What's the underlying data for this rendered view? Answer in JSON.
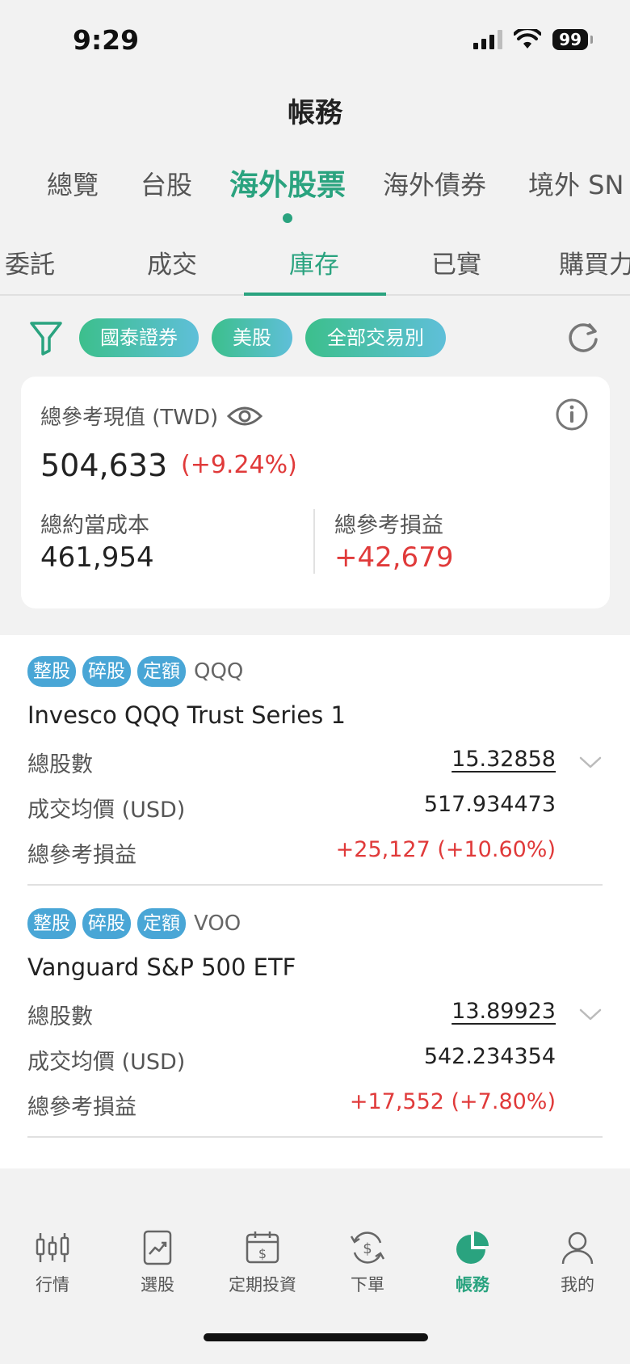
{
  "status_bar": {
    "time": "9:29",
    "battery": "99"
  },
  "header": {
    "title": "帳務"
  },
  "main_tabs": [
    {
      "label": "總覽"
    },
    {
      "label": "台股"
    },
    {
      "label": "海外股票"
    },
    {
      "label": "海外債券"
    },
    {
      "label": "境外 SN"
    }
  ],
  "sub_tabs": [
    {
      "label": "委託"
    },
    {
      "label": "成交"
    },
    {
      "label": "庫存"
    },
    {
      "label": "已實"
    },
    {
      "label": "購買力"
    }
  ],
  "filters": {
    "broker": "國泰證券",
    "market": "美股",
    "trade_type": "全部交易別"
  },
  "summary": {
    "value_label": "總參考現值 (TWD)",
    "value": "504,633",
    "value_pct": "(+9.24%)",
    "cost_label": "總約當成本",
    "cost": "461,954",
    "pl_label": "總參考損益",
    "pl": "+42,679"
  },
  "holdings": [
    {
      "tags": [
        "整股",
        "碎股",
        "定額"
      ],
      "ticker": "QQQ",
      "name": "Invesco QQQ Trust Series 1",
      "shares_label": "總股數",
      "shares": "15.32858",
      "avg_price_label": "成交均價 (USD)",
      "avg_price": "517.934473",
      "pl_label": "總參考損益",
      "pl": "+25,127 (+10.60%)"
    },
    {
      "tags": [
        "整股",
        "碎股",
        "定額"
      ],
      "ticker": "VOO",
      "name": "Vanguard S&P 500 ETF",
      "shares_label": "總股數",
      "shares": "13.89923",
      "avg_price_label": "成交均價 (USD)",
      "avg_price": "542.234354",
      "pl_label": "總參考損益",
      "pl": "+17,552 (+7.80%)"
    }
  ],
  "bottom_nav": [
    {
      "label": "行情",
      "icon": "candlestick-icon"
    },
    {
      "label": "選股",
      "icon": "chart-up-icon"
    },
    {
      "label": "定期投資",
      "icon": "calendar-dollar-icon"
    },
    {
      "label": "下單",
      "icon": "dollar-cycle-icon"
    },
    {
      "label": "帳務",
      "icon": "pie-chart-icon"
    },
    {
      "label": "我的",
      "icon": "user-icon"
    }
  ],
  "colors": {
    "accent": "#2aa37f",
    "loss_gain_red": "#e03a3a",
    "tag_blue": "#49a6d6"
  }
}
